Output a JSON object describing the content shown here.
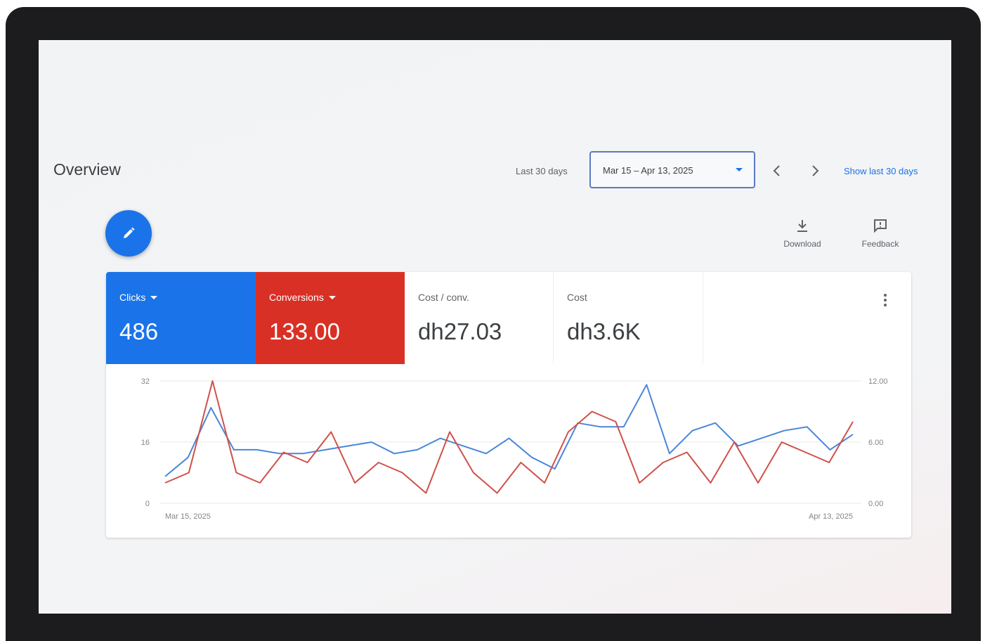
{
  "overview": {
    "title": "Overview",
    "range_label": "Last 30 days",
    "date_range": "Mar 15 – Apr 13, 2025",
    "prev_icon": "chevron-left-icon",
    "next_icon": "chevron-right-icon",
    "show_link": "Show last 30 days"
  },
  "toolbar": {
    "edit_icon": "pencil-icon",
    "download_label": "Download",
    "feedback_label": "Feedback"
  },
  "metrics": [
    {
      "label": "Clicks",
      "value": "486",
      "color": "#1a73e8"
    },
    {
      "label": "Conversions",
      "value": "133.00",
      "color": "#d93025"
    },
    {
      "label": "Cost / conv.",
      "value": "dh27.03"
    },
    {
      "label": "Cost",
      "value": "dh3.6K"
    }
  ],
  "chart_data": {
    "type": "line",
    "x_start_label": "Mar 15, 2025",
    "x_end_label": "Apr 13, 2025",
    "left_ticks": [
      "0",
      "16",
      "32"
    ],
    "right_ticks": [
      "0.00",
      "6.00",
      "12.00"
    ],
    "left_ylim": [
      0,
      32
    ],
    "right_ylim": [
      0,
      12
    ],
    "grid": true,
    "series": [
      {
        "name": "Clicks",
        "axis": "left",
        "color": "#4a86d8",
        "values": [
          7,
          12,
          25,
          14,
          14,
          13,
          13,
          14,
          15,
          16,
          13,
          14,
          17,
          15,
          13,
          17,
          12,
          9,
          21,
          20,
          20,
          31,
          13,
          19,
          21,
          15,
          17,
          19,
          20,
          14,
          18
        ]
      },
      {
        "name": "Conversions",
        "axis": "right",
        "color": "#d0504a",
        "values": [
          2.0,
          3.0,
          12.0,
          3.0,
          2.0,
          5.0,
          4.0,
          7.0,
          2.0,
          4.0,
          3.0,
          1.0,
          7.0,
          3.0,
          1.0,
          4.0,
          2.0,
          7.0,
          9.0,
          8.0,
          2.0,
          4.0,
          5.0,
          2.0,
          6.0,
          2.0,
          6.0,
          5.0,
          4.0,
          8.0
        ]
      }
    ]
  }
}
